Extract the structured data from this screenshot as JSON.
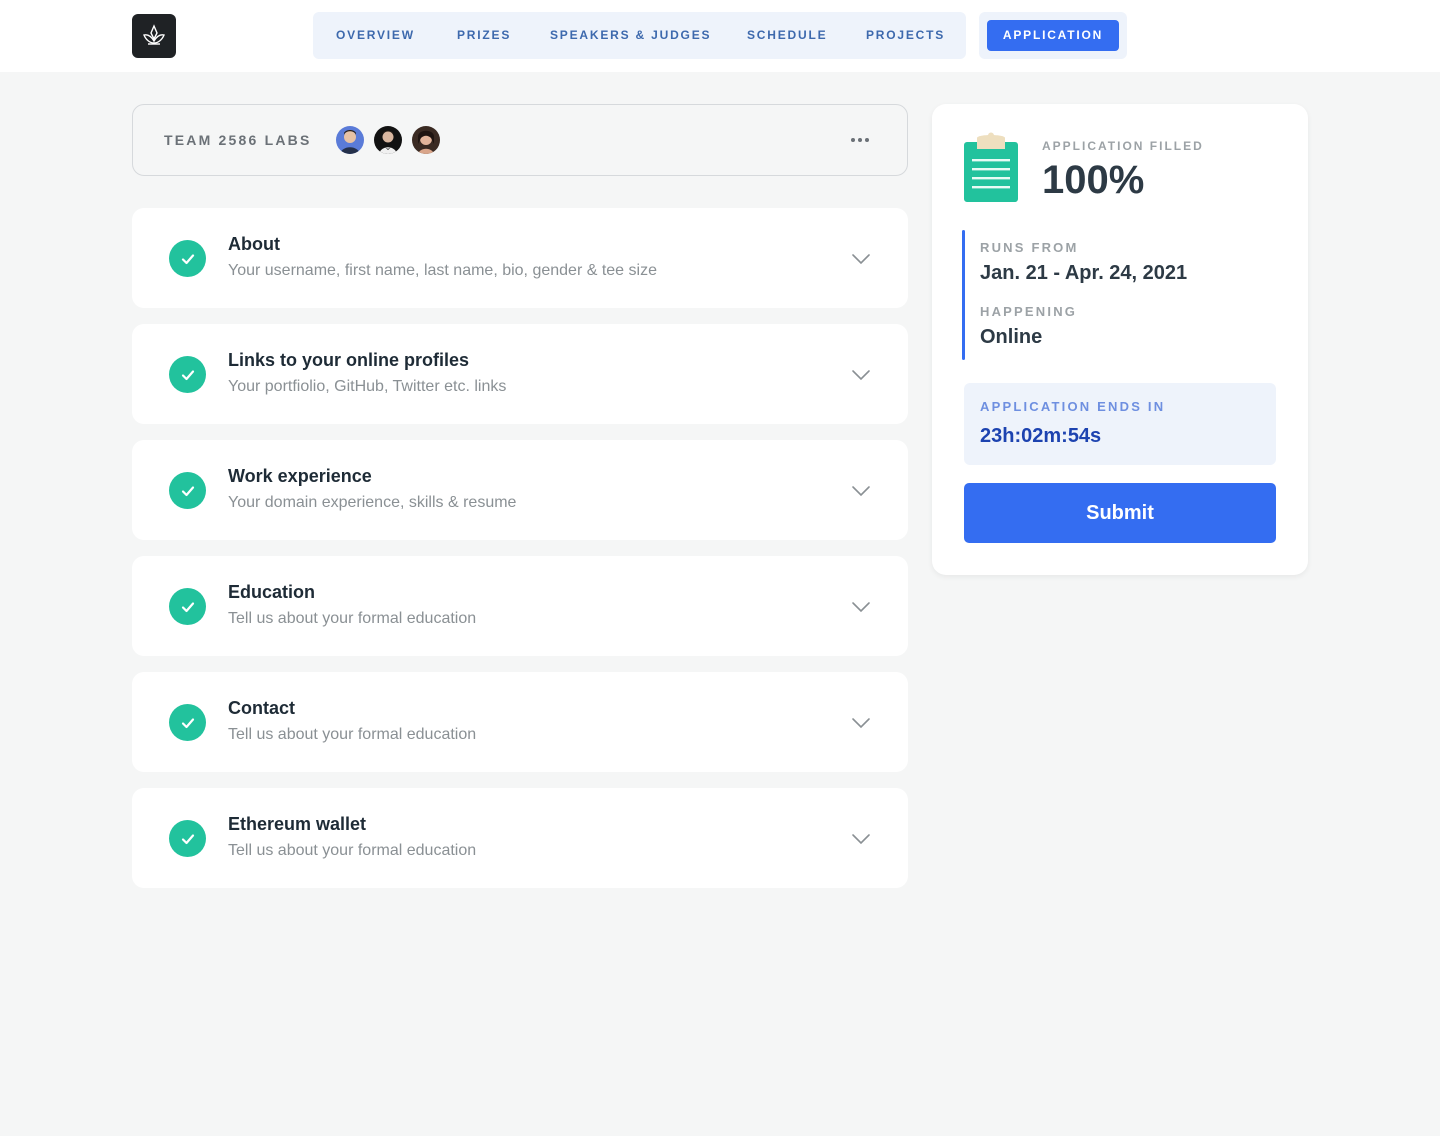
{
  "nav": {
    "items": [
      {
        "label": "OVERVIEW"
      },
      {
        "label": "PRIZES"
      },
      {
        "label": "SPEAKERS & JUDGES"
      },
      {
        "label": "SCHEDULE"
      },
      {
        "label": "PROJECTS"
      }
    ],
    "active_label": "APPLICATION"
  },
  "team": {
    "name": "TEAM 2586 LABS",
    "more_icon": "ellipsis-icon"
  },
  "sections": [
    {
      "title": "About",
      "subtitle": "Your username, first name, last name, bio, gender & tee size",
      "status": "complete"
    },
    {
      "title": "Links to your online profiles",
      "subtitle": "Your portfiolio, GitHub, Twitter etc. links",
      "status": "complete"
    },
    {
      "title": "Work experience",
      "subtitle": "Your domain experience, skills & resume",
      "status": "complete"
    },
    {
      "title": "Education",
      "subtitle": "Tell us about your formal education",
      "status": "complete"
    },
    {
      "title": "Contact",
      "subtitle": "Tell us about your formal education",
      "status": "complete"
    },
    {
      "title": "Ethereum wallet",
      "subtitle": "Tell us about your formal education",
      "status": "complete"
    }
  ],
  "summary": {
    "filled_label": "APPLICATION FILLED",
    "filled_value": "100%",
    "runs_label": "RUNS FROM",
    "runs_value": "Jan. 21 - Apr. 24, 2021",
    "happening_label": "HAPPENING",
    "happening_value": "Online",
    "ends_label": "APPLICATION ENDS IN",
    "ends_value": "23h:02m:54s",
    "submit_label": "Submit"
  },
  "colors": {
    "accent": "#346df1",
    "success": "#22c29d",
    "nav_bg": "#eef3fb",
    "page_bg": "#f5f6f6"
  }
}
